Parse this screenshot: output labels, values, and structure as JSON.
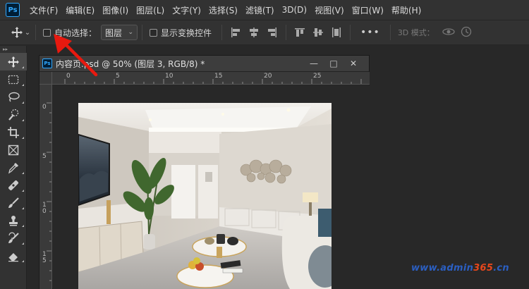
{
  "app": {
    "logo_text": "Ps"
  },
  "menu": [
    {
      "label": "文件(F)"
    },
    {
      "label": "编辑(E)"
    },
    {
      "label": "图像(I)"
    },
    {
      "label": "图层(L)"
    },
    {
      "label": "文字(Y)"
    },
    {
      "label": "选择(S)"
    },
    {
      "label": "滤镜(T)"
    },
    {
      "label": "3D(D)"
    },
    {
      "label": "视图(V)"
    },
    {
      "label": "窗口(W)"
    },
    {
      "label": "帮助(H)"
    }
  ],
  "options_bar": {
    "auto_select_label": "自动选择：",
    "auto_select_checked": false,
    "auto_select_target": "图层",
    "show_transform_label": "显示变换控件",
    "show_transform_checked": false,
    "more_label": "•••",
    "mode_3d_label": "3D 模式："
  },
  "tools": [
    {
      "icon": "move-icon"
    },
    {
      "icon": "marquee-icon"
    },
    {
      "icon": "lasso-icon"
    },
    {
      "icon": "quick-select-icon"
    },
    {
      "icon": "crop-icon"
    },
    {
      "icon": "frame-icon"
    },
    {
      "icon": "eyedropper-icon"
    },
    {
      "icon": "healing-icon"
    },
    {
      "icon": "brush-icon"
    },
    {
      "icon": "stamp-icon"
    },
    {
      "icon": "history-brush-icon"
    },
    {
      "icon": "eraser-icon"
    }
  ],
  "document": {
    "title": "内容页.psd @ 50% (图层 3, RGB/8) *",
    "ps_badge": "Ps",
    "minimize_label": "—",
    "maximize_label": "□",
    "close_label": "✕",
    "ruler_top": [
      "0",
      "5",
      "10",
      "15",
      "20",
      "25"
    ],
    "ruler_left": [
      "0",
      "5",
      "1\n0",
      "1\n5"
    ]
  },
  "watermark": {
    "prefix": "www.admin",
    "number": "365",
    "suffix": ".cn"
  },
  "colors": {
    "accent": "#31a8ff",
    "annotation_arrow": "#e8190f",
    "watermark_blue": "#2b5fc2",
    "watermark_orange": "#e7471c"
  }
}
